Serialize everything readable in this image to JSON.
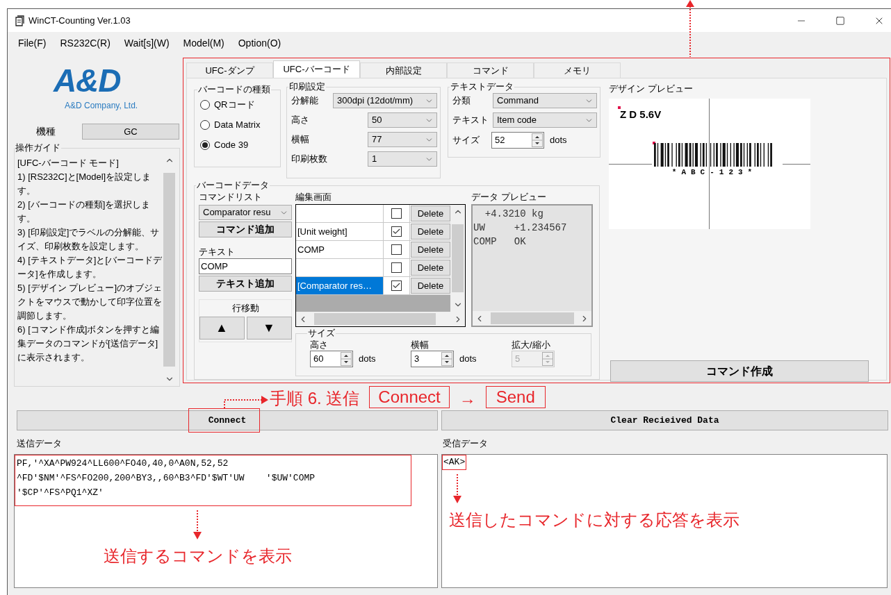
{
  "window": {
    "title": "WinCT-Counting Ver.1.03"
  },
  "menu": [
    "File(F)",
    "RS232C(R)",
    "Wait[s](W)",
    "Model(M)",
    "Option(O)"
  ],
  "sidebar": {
    "logo": "A&D",
    "logo_caption": "A&D Company, Ltd.",
    "model_label": "機種",
    "model_value": "GC",
    "guide": {
      "title": "操作ガイド",
      "lines": [
        "[UFC-バーコード モード]",
        "1) [RS232C]と[Model]を設定します。",
        "2) [バーコードの種類]を選択します。",
        "3) [印刷設定]でラベルの分解能、サイズ、印刷枚数を設定します。",
        "4) [テキストデータ]と[バーコードデータ]を作成します。",
        "5) [デザイン プレビュー]のオブジェクトをマウスで動かして印字位置を調節します。",
        "6) [コマンド作成]ボタンを押すと編集データのコマンドが[送信データ]に表示されます。"
      ]
    }
  },
  "tabs": [
    {
      "label": "UFC-ダンプ",
      "selected": false
    },
    {
      "label": "UFC-バーコード",
      "selected": true
    },
    {
      "label": "内部設定",
      "selected": false
    },
    {
      "label": "コマンド",
      "selected": false
    },
    {
      "label": "メモリ",
      "selected": false
    }
  ],
  "barcode_type": {
    "title": "バーコードの種類",
    "options": [
      {
        "label": "QRコード",
        "selected": false
      },
      {
        "label": "Data Matrix",
        "selected": false
      },
      {
        "label": "Code 39",
        "selected": true
      }
    ]
  },
  "print_settings": {
    "title": "印刷設定",
    "fields": [
      {
        "label": "分解能",
        "value": "300dpi (12dot/mm)"
      },
      {
        "label": "高さ",
        "value": "50"
      },
      {
        "label": "横幅",
        "value": "77"
      },
      {
        "label": "印刷枚数",
        "value": "1"
      }
    ]
  },
  "text_data": {
    "title": "テキストデータ",
    "category": {
      "label": "分類",
      "value": "Command"
    },
    "text": {
      "label": "テキスト",
      "value": "Item code"
    },
    "size": {
      "label": "サイズ",
      "value": "52",
      "unit": "dots"
    }
  },
  "barcode_data": {
    "title": "バーコードデータ",
    "command_list": {
      "label": "コマンドリスト",
      "value": "Comparator resu"
    },
    "add_command": "コマンド追加",
    "text": {
      "label": "テキスト",
      "value": "COMP"
    },
    "add_text": "テキスト追加",
    "row_move": {
      "title": "行移動",
      "up": "▲",
      "down": "▼"
    },
    "editor": {
      "title": "編集画面",
      "rows": [
        {
          "checked": false,
          "selected": false,
          "action": "Delete"
        },
        {
          "text": "[Unit weight]",
          "checked": true,
          "selected": false,
          "action": "Delete"
        },
        {
          "text": "COMP",
          "checked": false,
          "selected": false,
          "action": "Delete"
        },
        {
          "checked": false,
          "selected": false,
          "action": "Delete"
        },
        {
          "text": "[Comparator res…",
          "checked": true,
          "selected": true,
          "action": "Delete"
        }
      ]
    },
    "data_preview": {
      "title": "データ プレビュー",
      "lines": [
        "  +4.3210 kg",
        "UW     +1.234567",
        "COMP   OK"
      ]
    },
    "size": {
      "title": "サイズ",
      "height": {
        "label": "高さ",
        "value": "60",
        "unit": "dots"
      },
      "width": {
        "label": "横幅",
        "value": "3",
        "unit": "dots"
      },
      "scale": {
        "label": "拡大/縮小",
        "value": "5",
        "disabled": true
      }
    }
  },
  "design_preview": {
    "title": "デザイン プレビュー",
    "label_text": "Z D 5.6V",
    "barcode_caption": "*ABC-123*",
    "button": "コマンド作成"
  },
  "bottom": {
    "connect_button": "Connect",
    "clear_button": "Clear Recieived Data",
    "sent": {
      "label": "送信データ",
      "lines": [
        "PF,'^XA^PW924^LL600^FO40,40,0^A0N,52,52",
        "^FD'$NM'^FS^FO200,200^BY3,,60^B3^FD'$WT'UW    '$UW'COMP",
        "'$CP'^FS^PQ1^XZ'"
      ]
    },
    "received": {
      "label": "受信データ",
      "lines": [
        "<AK>"
      ]
    }
  },
  "annotations": {
    "step": "手順 6. 送信",
    "connect": "Connect",
    "arrow": "→",
    "send": "Send",
    "sent_note": "送信するコマンドを表示",
    "received_note": "送信したコマンドに対する応答を表示"
  }
}
